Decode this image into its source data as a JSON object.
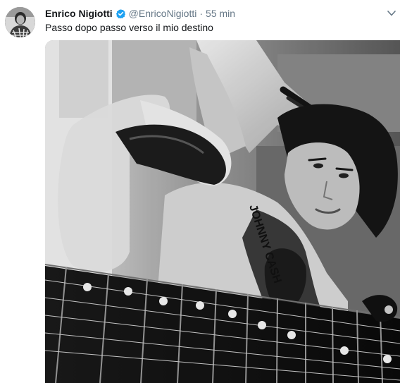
{
  "tweet": {
    "author_name": "Enrico Nigiotti",
    "handle": "@EnricoNigiotti",
    "separator": "·",
    "time": "55 min",
    "text": "Passo dopo passo verso il mio destino",
    "verified_icon": "verified-badge-icon",
    "caret_icon": "chevron-down-icon",
    "media": {
      "kind": "photo",
      "style": "black-and-white",
      "shirt_print": "JOHNNY CASH"
    },
    "colors": {
      "verified": "#1da1f2",
      "secondary_text": "#657786",
      "primary_text": "#14171a"
    }
  }
}
